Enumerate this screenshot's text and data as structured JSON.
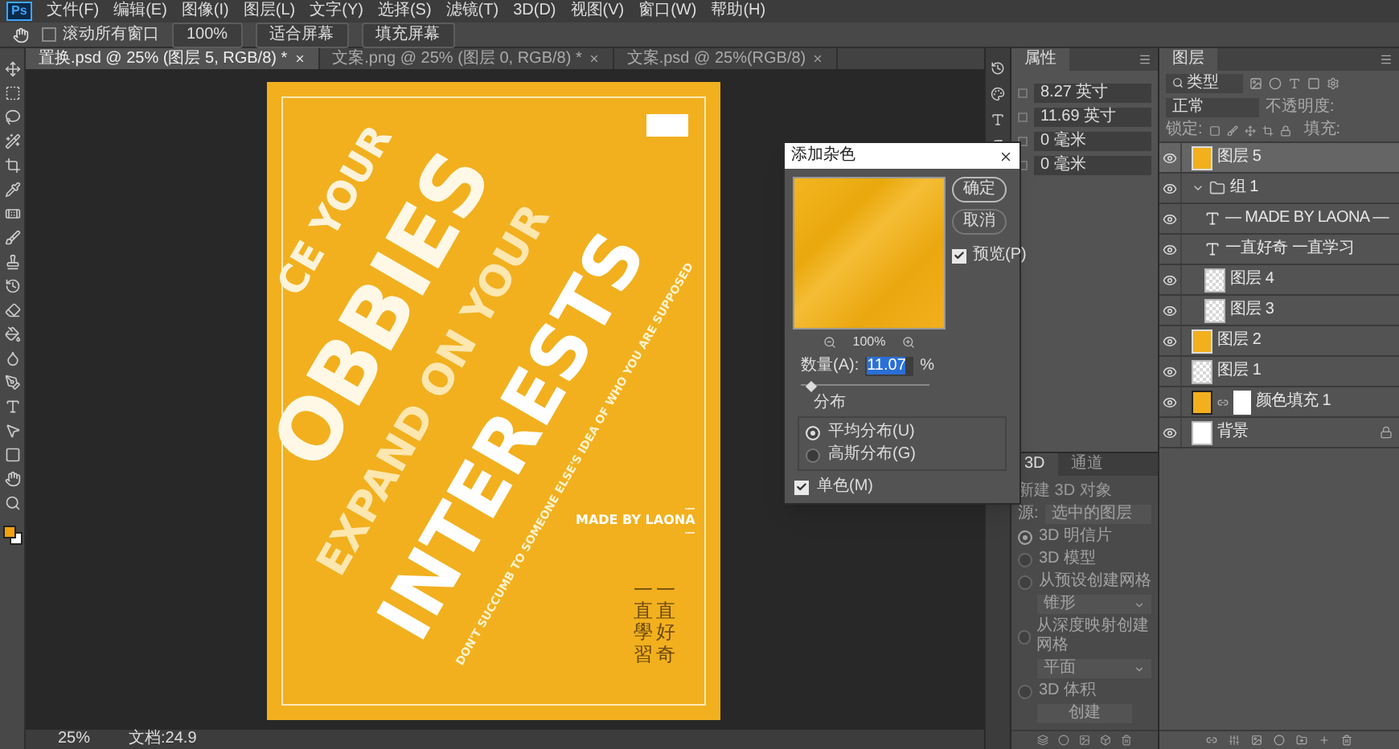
{
  "app": {
    "logo": "Ps"
  },
  "menu": [
    "文件(F)",
    "编辑(E)",
    "图像(I)",
    "图层(L)",
    "文字(Y)",
    "选择(S)",
    "滤镜(T)",
    "3D(D)",
    "视图(V)",
    "窗口(W)",
    "帮助(H)"
  ],
  "options_bar": {
    "scroll_all": {
      "label": "滚动所有窗口",
      "checked": false
    },
    "buttons": [
      "100%",
      "适合屏幕",
      "填充屏幕"
    ]
  },
  "tabs": [
    {
      "label": "置换.psd @ 25% (图层 5, RGB/8) *",
      "selected": true
    },
    {
      "label": "文案.png @ 25% (图层 0, RGB/8) *",
      "selected": false
    },
    {
      "label": "文案.psd @ 25%(RGB/8)",
      "selected": false
    }
  ],
  "poster": {
    "lines": [
      "CE YOUR",
      "OBBIES",
      "EXPAND ON YOUR",
      "INTERESTS",
      "DON'T SUCCUMB TO SOMEONE ELSE'S IDEA OF WHO YOU ARE SUPPOSED"
    ],
    "credit": "MADE BY LAONA",
    "vertical_text": [
      "一直學習",
      "一直好奇"
    ]
  },
  "dialog": {
    "title": "添加杂色",
    "zoom": "100%",
    "ok": "确定",
    "cancel": "取消",
    "preview": {
      "label": "预览(P)",
      "checked": true
    },
    "amount_label": "数量(A):",
    "amount": "11.07",
    "unit": "%",
    "level": 0.08,
    "distribution_label": "分布",
    "distribution": [
      {
        "label": "平均分布(U)",
        "selected": true
      },
      {
        "label": "高斯分布(G)",
        "selected": false
      }
    ],
    "mono": {
      "label": "单色(M)",
      "checked": true
    }
  },
  "properties": {
    "tab": "属性",
    "width": "8.27 英寸",
    "height": "11.69 英寸",
    "x": "0 毫米",
    "y": "0 毫米"
  },
  "panel_3d": {
    "tabs": [
      {
        "label": "3D",
        "selected": true
      },
      {
        "label": "通道",
        "selected": false
      }
    ],
    "title": "新建 3D 对象",
    "source_label": "源:",
    "source_value": "选中的图层",
    "disabled": true,
    "options": [
      {
        "kind": "radio",
        "label": "3D 明信片",
        "selected": true
      },
      {
        "kind": "radio",
        "label": "3D 模型",
        "selected": false
      },
      {
        "kind": "radio",
        "label": "从预设创建网格",
        "selected": false
      },
      {
        "kind": "dropdown",
        "value": "锥形"
      },
      {
        "kind": "radio",
        "label": "从深度映射创建网格",
        "selected": false
      },
      {
        "kind": "dropdown",
        "value": "平面"
      },
      {
        "kind": "radio",
        "label": "3D 体积",
        "selected": false
      }
    ],
    "create_button": "创建"
  },
  "layers_panel": {
    "tab": "图层",
    "filter": "类型",
    "blend_mode": "正常",
    "opacity_label": "不透明度:",
    "lock_label": "锁定:",
    "fill_label": "填充:",
    "layers": [
      {
        "kind": "pixel",
        "name": "图层 5",
        "thumbnail": {
          "kind": "poster"
        },
        "visible": true,
        "selected": true
      },
      {
        "kind": "group",
        "name": "组 1",
        "visible": true,
        "selected": false,
        "expanded": true,
        "children": [
          {
            "kind": "text",
            "name": "— MADE BY LAONA —",
            "visible": true,
            "selected": false
          },
          {
            "kind": "text",
            "name": "一直好奇 一直学习",
            "visible": true,
            "selected": false
          },
          {
            "kind": "pixel",
            "name": "图层 4",
            "thumbnail": {
              "kind": "transparent"
            },
            "visible": true,
            "selected": false
          },
          {
            "kind": "pixel",
            "name": "图层 3",
            "thumbnail": {
              "kind": "transparent"
            },
            "visible": true,
            "selected": false
          }
        ]
      },
      {
        "kind": "pixel",
        "name": "图层 2",
        "thumbnail": {
          "kind": "poster"
        },
        "visible": true,
        "selected": false
      },
      {
        "kind": "pixel",
        "name": "图层 1",
        "thumbnail": {
          "kind": "transparent"
        },
        "visible": true,
        "selected": false
      },
      {
        "kind": "fill",
        "name": "颜色填充 1",
        "thumbnail": {
          "kind": "yellow"
        },
        "visible": true,
        "selected": false
      },
      {
        "kind": "pixel",
        "name": "背景",
        "thumbnail": {
          "kind": "white"
        },
        "visible": true,
        "selected": false,
        "locked": true
      }
    ]
  },
  "status_bar": {
    "zoom": "25%",
    "doc": "文档:24.9"
  }
}
